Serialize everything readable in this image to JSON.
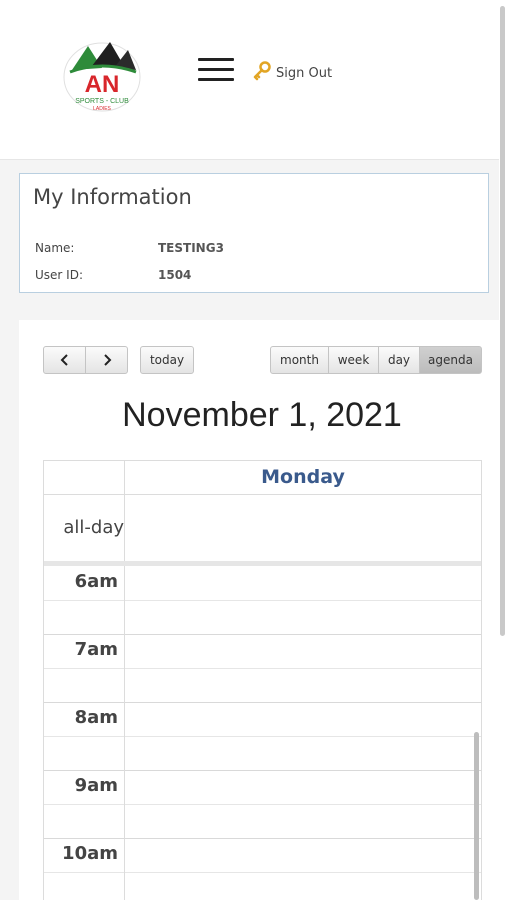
{
  "header": {
    "logo_text": "AN SPORTS CLUB LADIES",
    "menu_icon": "hamburger-icon",
    "signout_icon": "key-icon",
    "signout_label": "Sign Out"
  },
  "info": {
    "title": "My Information",
    "fields": [
      {
        "label": "Name:",
        "value": "TESTING3"
      },
      {
        "label": "User ID:",
        "value": "1504"
      }
    ]
  },
  "calendar": {
    "prev_icon": "chevron-left-icon",
    "next_icon": "chevron-right-icon",
    "today_label": "today",
    "views": [
      "month",
      "week",
      "day",
      "agenda"
    ],
    "active_view": "agenda",
    "title": "November 1, 2021",
    "day_header": "Monday",
    "allday_label": "all-day",
    "hours": [
      "6am",
      "7am",
      "8am",
      "9am",
      "10am"
    ]
  },
  "colors": {
    "day_header": "#3a5a8c",
    "info_border": "#b9cfe0"
  }
}
